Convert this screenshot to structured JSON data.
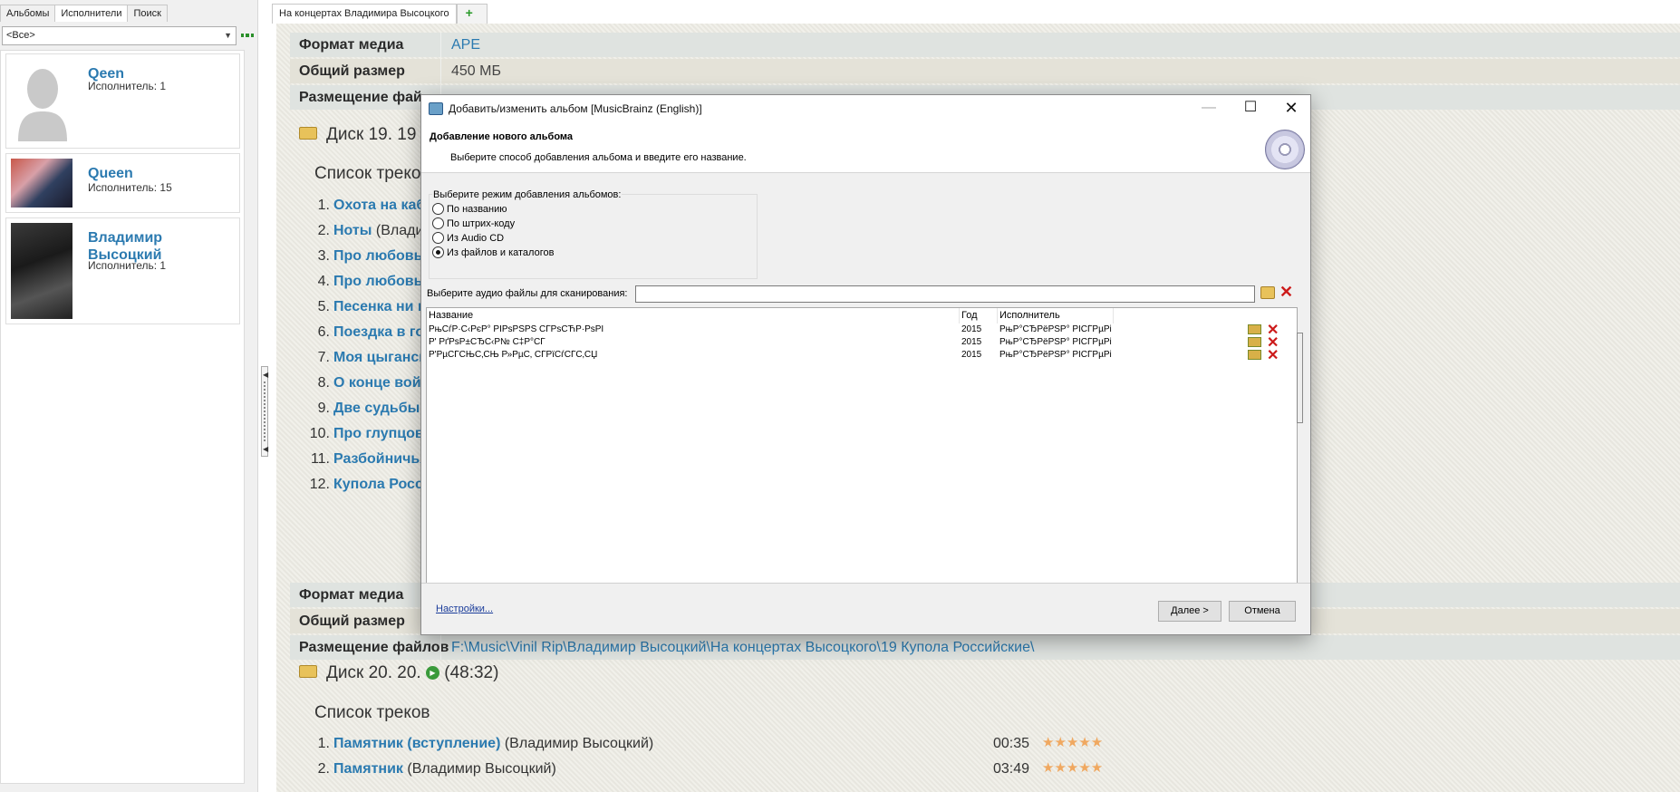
{
  "left_panel": {
    "tabs": [
      "Альбомы",
      "Исполнители",
      "Поиск"
    ],
    "active_tab": 1,
    "filter_value": "<Все>",
    "artists": [
      {
        "name": "Qeen",
        "count_label": "Исполнитель: 1",
        "photo": "placeholder-avatar"
      },
      {
        "name": "Queen",
        "count_label": "Исполнитель: 15",
        "photo": "band-photo"
      },
      {
        "name": "Владимир Высоцкий",
        "count_label": "Исполнитель: 1",
        "photo": "singer-photo"
      }
    ]
  },
  "doc_tabs": {
    "active": "На концертах Владимира Высоцкого",
    "new_tab": "+"
  },
  "album_view": {
    "props_top": [
      {
        "key": "Формат медиа",
        "value": "APE",
        "link": true
      },
      {
        "key": "Общий размер",
        "value": "450 МБ",
        "link": false
      },
      {
        "key": "Размещение фай",
        "value": "",
        "link": true
      }
    ],
    "disc19_title": "Диск 19. 19",
    "tracklist_label": "Список треков",
    "disc19_tracks": [
      {
        "num": "1.",
        "title": "Охота на каб",
        "artist": ""
      },
      {
        "num": "2.",
        "title": "Ноты",
        "artist": " (Влади"
      },
      {
        "num": "3.",
        "title": "Про любовь",
        "artist": ""
      },
      {
        "num": "4.",
        "title": "Про любовь",
        "artist": ""
      },
      {
        "num": "5.",
        "title": "Песенка ни п",
        "artist": ""
      },
      {
        "num": "6.",
        "title": "Поездка в го",
        "artist": ""
      },
      {
        "num": "7.",
        "title": "Моя цыганск",
        "artist": ""
      },
      {
        "num": "8.",
        "title": "О конце войн",
        "artist": ""
      },
      {
        "num": "9.",
        "title": "Две судьбы",
        "artist": ""
      },
      {
        "num": "10.",
        "title": "Про глупцов",
        "artist": ""
      },
      {
        "num": "11.",
        "title": "Разбойничья",
        "artist": ""
      },
      {
        "num": "12.",
        "title": "Купола Росс",
        "artist": ""
      }
    ],
    "props_bottom": [
      {
        "key": "Формат медиа",
        "value": "",
        "link": false
      },
      {
        "key": "Общий размер",
        "value": "",
        "link": false
      },
      {
        "key": "Размещение файлов",
        "value": "F:\\Music\\Vinil Rip\\Владимир Высоцкий\\На концертах Высоцкого\\19 Купола Российские\\",
        "link": true
      }
    ],
    "disc20_title": "Диск 20. 20.",
    "disc20_duration": "(48:32)",
    "disc20_tracks": [
      {
        "num": "1.",
        "title": "Памятник (вступление)",
        "artist": " (Владимир Высоцкий)",
        "duration": "00:35",
        "rating": 5
      },
      {
        "num": "2.",
        "title": "Памятник",
        "artist": " (Владимир Высоцкий)",
        "duration": "03:49",
        "rating": 5
      }
    ]
  },
  "dialog": {
    "title": "Добавить/изменить альбом [MusicBrainz (English)]",
    "header_title": "Добавление нового альбома",
    "header_subtitle": "Выберите способ добавления альбома и введите его название.",
    "mode_group_label": "Выберите режим добавления альбомов:",
    "modes": [
      "По названию",
      "По штрих-коду",
      "Из Audio CD",
      "Из файлов и каталогов"
    ],
    "selected_mode": 3,
    "scan_label": "Выберите аудио файлы для сканирования:",
    "scan_value": "",
    "columns": [
      "Название",
      "Год",
      "Исполнитель"
    ],
    "files": [
      {
        "name": "РњСѓР·С‹РєР° РІРѕРЅРЅ СЃРѕСЋР·РѕРІ",
        "year": "2015",
        "artist": "РњР°СЂРёРЅР° РІСЃРµРіРґР°..."
      },
      {
        "name": "Р' РґРѕР±СЂС‹Р№ С‡Р°СЃ",
        "year": "2015",
        "artist": "РњР°СЂРёРЅР° РІСЃРµРіРґР°..."
      },
      {
        "name": "Р'РµСЃСЊС‚СЊ Р»РµС‚ СЃРїСѓСЃС‚СЏ",
        "year": "2015",
        "artist": "РњР°СЂРёРЅР° РІСЃРµРіРґР°..."
      }
    ],
    "settings_link": "Настройки...",
    "next_label": "Далее >",
    "cancel_label": "Отмена"
  },
  "colors": {
    "link": "#2b7ab0",
    "delete": "#cc1a1a",
    "rating": "#f0a860"
  }
}
